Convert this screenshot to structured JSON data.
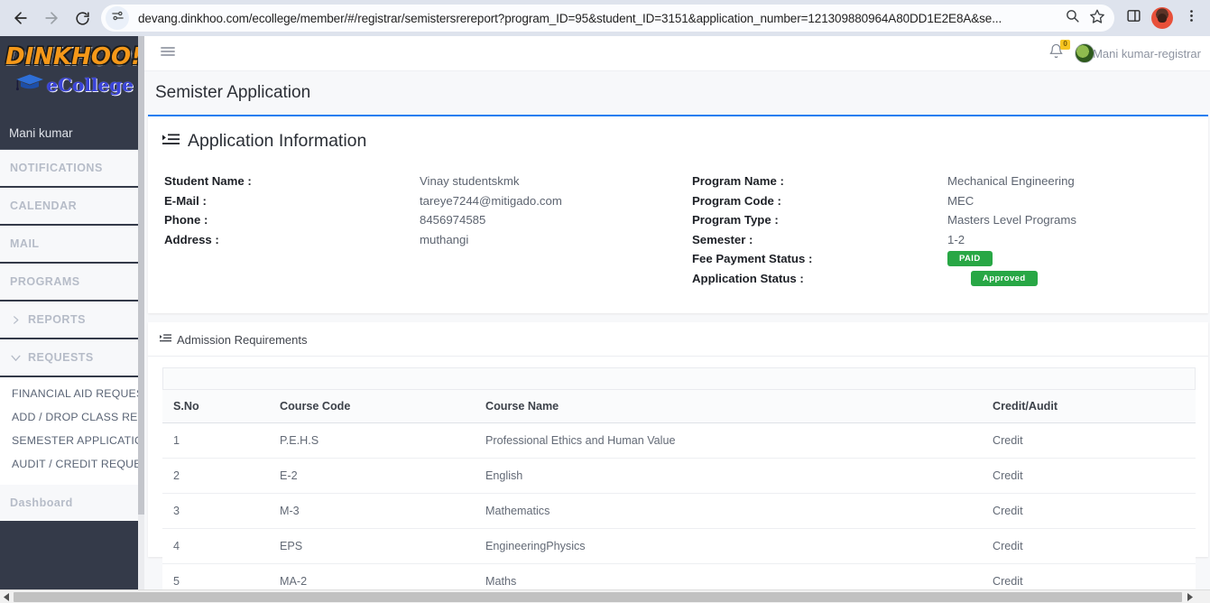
{
  "browser": {
    "back_icon": "arrow-left-icon",
    "forward_icon": "arrow-right-icon",
    "reload_icon": "reload-icon",
    "site_settings_icon": "tune-icon",
    "url_domain": "devang.dinkhoo.com",
    "url_path": "/ecollege/member/#/registrar/semistersrereport?program_ID=95&student_ID=3151&application_number=121309880964A80DD1E2E8A&se...",
    "url_full": "devang.dinkhoo.com/ecollege/member/#/registrar/semistersrereport?program_ID=95&student_ID=3151&application_number=121309880964A80DD1E2E8A&se...",
    "search_icon": "search-icon",
    "bookmark_icon": "star-icon",
    "side_panel_icon": "side-panel-icon",
    "profile_icon": "profile-avatar",
    "menu_icon": "three-dot-menu-icon"
  },
  "sidebar": {
    "logo_main": "DINKHOO!",
    "logo_sub": "eCollege",
    "logo_cap_icon": "graduation-cap-icon",
    "user_name": "Mani kumar",
    "sections": [
      {
        "label": "NOTIFICATIONS",
        "chevron": null
      },
      {
        "label": "CALENDAR",
        "chevron": null
      },
      {
        "label": "MAIL",
        "chevron": null
      },
      {
        "label": "PROGRAMS",
        "chevron": null
      },
      {
        "label": "REPORTS",
        "chevron": "chevron-right-icon"
      },
      {
        "label": "REQUESTS",
        "chevron": "chevron-down-icon"
      }
    ],
    "submenu": [
      "FINANCIAL AID REQUESTS",
      "ADD / DROP CLASS REQUESTS",
      "SEMESTER APPLICATIONS",
      "AUDIT / CREDIT REQUEST"
    ],
    "dashboard_label": "Dashboard"
  },
  "topbar": {
    "hamburger_icon": "hamburger-menu-icon",
    "bell_icon": "bell-icon",
    "bell_count": "0",
    "user_label": "Mani kumar-registrar",
    "avatar_icon": "user-avatar"
  },
  "page": {
    "title": "Semister Application"
  },
  "application_info": {
    "section_icon": "list-indent-icon",
    "section_title": "Application Information",
    "left": [
      {
        "label": "Student Name :",
        "value": "Vinay studentskmk"
      },
      {
        "label": "E-Mail :",
        "value": "tareye7244@mitigado.com"
      },
      {
        "label": "Phone :",
        "value": "8456974585"
      },
      {
        "label": "Address :",
        "value": "muthangi"
      }
    ],
    "right": [
      {
        "label": "Program Name :",
        "value": "Mechanical Engineering",
        "type": "text"
      },
      {
        "label": "Program Code :",
        "value": "MEC",
        "type": "text"
      },
      {
        "label": "Program Type :",
        "value": "Masters Level Programs",
        "type": "text"
      },
      {
        "label": "Semester :",
        "value": "1-2",
        "type": "text"
      },
      {
        "label": "Fee Payment Status :",
        "value": "PAID",
        "type": "badge"
      },
      {
        "label": "Application Status :",
        "value": "Approved",
        "type": "badge-indent"
      }
    ],
    "badge_color": "#28a745"
  },
  "admission_requirements": {
    "section_icon": "list-indent-icon",
    "section_title": "Admission Requirements",
    "columns": [
      "S.No",
      "Course Code",
      "Course Name",
      "Credit/Audit"
    ],
    "rows": [
      {
        "sno": "1",
        "code": "P.E.H.S",
        "name": "Professional Ethics and Human Value",
        "credit": "Credit"
      },
      {
        "sno": "2",
        "code": "E-2",
        "name": "English",
        "credit": "Credit"
      },
      {
        "sno": "3",
        "code": "M-3",
        "name": "Mathematics",
        "credit": "Credit"
      },
      {
        "sno": "4",
        "code": "EPS",
        "name": "EngineeringPhysics",
        "credit": "Credit"
      },
      {
        "sno": "5",
        "code": "MA-2",
        "name": "Maths",
        "credit": "Credit"
      }
    ]
  },
  "colors": {
    "sidebar_bg": "#343a49",
    "accent_blue": "#1a7ef0",
    "badge_green": "#28a745",
    "logo_orange": "#f59819",
    "logo_blue": "#3a44d8"
  }
}
